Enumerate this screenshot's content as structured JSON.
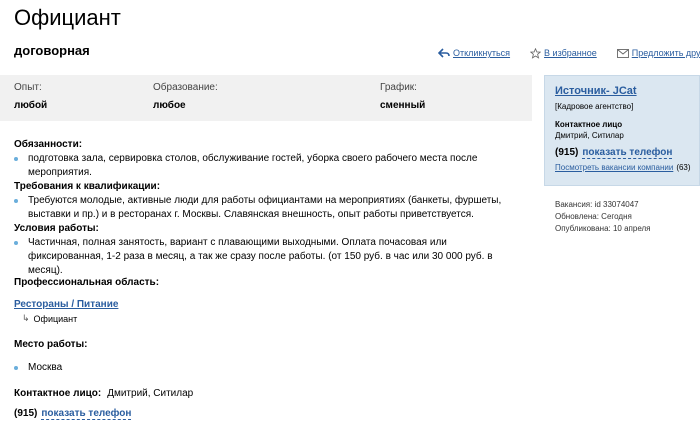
{
  "vacancy": {
    "title": "Официант",
    "salary": "договорная"
  },
  "actions": [
    {
      "label": "Откликнуться",
      "icon": "reply-arrow-icon"
    },
    {
      "label": "В избранное",
      "icon": "star-icon"
    },
    {
      "label": "Предложить другу",
      "icon": "envelope-icon"
    }
  ],
  "meta": {
    "experience_label": "Опыт:",
    "experience_value": "любой",
    "education_label": "Образование:",
    "education_value": "любое",
    "schedule_label": "График:",
    "schedule_value": "сменный"
  },
  "description": {
    "duties_heading": "Обязанности:",
    "duties": [
      "подготовка зала, сервировка столов, обслуживание гостей, уборка своего рабочего места после мероприятия."
    ],
    "requirements_heading": "Требования к квалификации:",
    "requirements": [
      "Требуются молодые, активные люди для работы официантами на мероприятиях (банкеты, фуршеты, выставки и пр.) и в ресторанах г. Москвы. Славянская внешность, опыт работы приветствуется."
    ],
    "conditions_heading": "Условия работы:",
    "conditions": [
      "Частичная, полная занятость, вариант с плавающими выходными. Оплата почасовая или фиксированная, 1-2 раза в месяц, а так же сразу после работы. (от 150 руб. в час или 30 000 руб. в месяц)."
    ]
  },
  "professional": {
    "heading": "Профессиональная область:",
    "area": "Рестораны / Питание",
    "sub": "Официант",
    "sub_icon": "return-arrow-icon"
  },
  "location": {
    "heading": "Место работы:",
    "city": "Москва"
  },
  "contact": {
    "label": "Контактное лицо:",
    "name": "Дмитрий, Ситилар",
    "phone_code": "(915)",
    "phone_link": "показать телефон"
  },
  "employer_card": {
    "name": "Источник- JCat",
    "type": "[Кадровое агентство]",
    "contact_label": "Контактное лицо",
    "contact_name": "Дмитрий, Ситилар",
    "phone_code": "(915)",
    "phone_link": "показать телефон",
    "vacancies_link": "Посмотреть вакансии компании",
    "vacancies_count": "(63)"
  },
  "side_info": {
    "vacancy_id": "Вакансия: id 33074047",
    "updated": "Обновлена: Сегодня",
    "published": "Опубликована: 10 апреля"
  },
  "colors": {
    "link": "#2a5d9f",
    "meta_bar": "#f1f1f1",
    "card_bg": "#dbe7f1",
    "bullet": "#6aaedb"
  }
}
